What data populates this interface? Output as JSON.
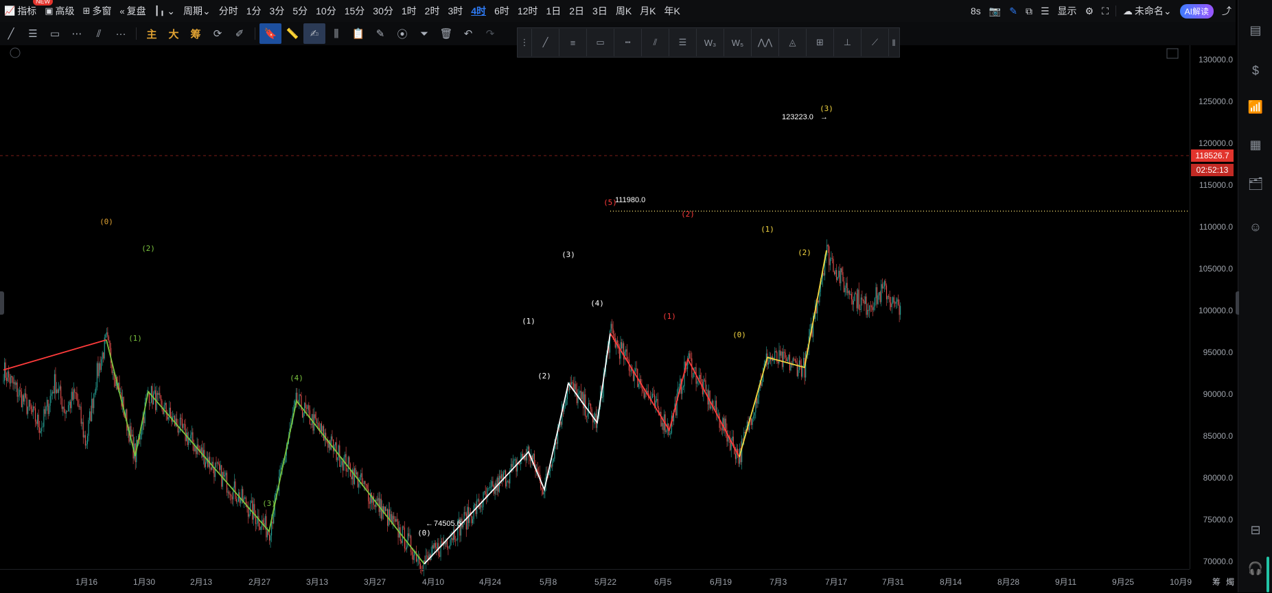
{
  "toolbar_top": {
    "indicators": "指标",
    "new_badge": "NEW",
    "advanced": "高级",
    "multi_window": "多窗",
    "replay": "复盘",
    "period": "周期",
    "periods": [
      "分时",
      "1分",
      "3分",
      "5分",
      "10分",
      "15分",
      "30分",
      "1时",
      "2时",
      "3时",
      "4时",
      "6时",
      "12时",
      "1日",
      "2日",
      "3日",
      "周K",
      "月K",
      "年K"
    ],
    "active_period": "4时",
    "refresh": "8s",
    "display": "显示",
    "unnamed": "未命名",
    "ai": "AI解读"
  },
  "toolbar_draw": {
    "main": "主",
    "big": "大",
    "chip": "筹"
  },
  "yaxis_labels": [
    "130000.0",
    "125000.0",
    "120000.0",
    "115000.0",
    "110000.0",
    "105000.0",
    "100000.0",
    "95000.0",
    "90000.0",
    "85000.0",
    "80000.0",
    "75000.0",
    "70000.0"
  ],
  "xaxis_labels": [
    "1月16",
    "1月30",
    "2月13",
    "2月27",
    "3月13",
    "3月27",
    "4月10",
    "4月24",
    "5月8",
    "5月22",
    "6月5",
    "6月19",
    "7月3",
    "7月17",
    "7月31",
    "8月14",
    "8月28",
    "9月11",
    "9月25",
    "10月9"
  ],
  "xaxis_right": [
    "筹",
    "燭"
  ],
  "current_price": "118526.7",
  "countdown": "02:52:13",
  "annotations": {
    "high": "123223.0",
    "mid_high": "111980.0",
    "low": "74505.6"
  },
  "wave_labels": {
    "green": [
      "(0)",
      "(1)",
      "(2)",
      "(3)",
      "(4)",
      "(0)"
    ],
    "white": [
      "(1)",
      "(2)",
      "(3)",
      "(4)",
      "(5)"
    ],
    "red": [
      "(1)",
      "(2)"
    ],
    "yellow": [
      "(0)",
      "(1)",
      "(2)",
      "(3)"
    ]
  },
  "colors": {
    "up": "#26a69a",
    "down": "#ef5350",
    "green_wave": "#7cc43f",
    "white_wave": "#ffffff",
    "red_wave": "#ff3b3b",
    "yellow_wave": "#f5d742",
    "accent": "#2f7cf6"
  }
}
